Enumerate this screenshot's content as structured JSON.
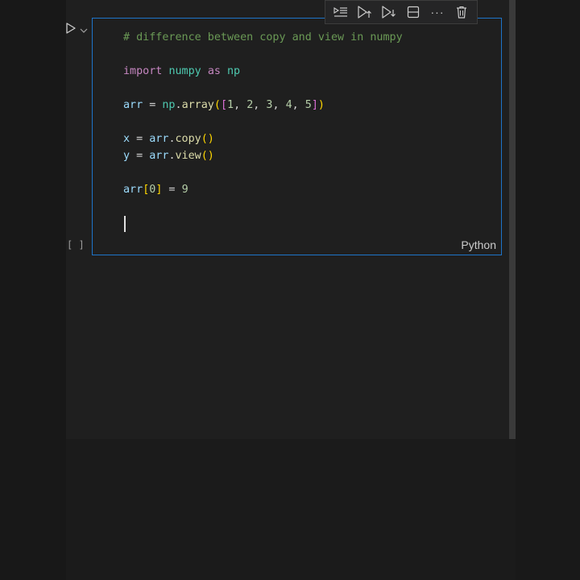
{
  "cell": {
    "language": "Python",
    "execution_count": "[ ]",
    "code_lines": [
      [
        {
          "t": "# difference between copy and view in numpy",
          "c": "comment"
        }
      ],
      [],
      [
        {
          "t": "import",
          "c": "keyword"
        },
        {
          "t": " ",
          "c": "op"
        },
        {
          "t": "numpy",
          "c": "module"
        },
        {
          "t": " ",
          "c": "op"
        },
        {
          "t": "as",
          "c": "keyword"
        },
        {
          "t": " ",
          "c": "op"
        },
        {
          "t": "np",
          "c": "module"
        }
      ],
      [],
      [
        {
          "t": "arr",
          "c": "var"
        },
        {
          "t": " = ",
          "c": "op"
        },
        {
          "t": "np",
          "c": "module"
        },
        {
          "t": ".",
          "c": "op"
        },
        {
          "t": "array",
          "c": "func"
        },
        {
          "t": "(",
          "c": "paren1"
        },
        {
          "t": "[",
          "c": "paren2"
        },
        {
          "t": "1",
          "c": "num"
        },
        {
          "t": ", ",
          "c": "op"
        },
        {
          "t": "2",
          "c": "num"
        },
        {
          "t": ", ",
          "c": "op"
        },
        {
          "t": "3",
          "c": "num"
        },
        {
          "t": ", ",
          "c": "op"
        },
        {
          "t": "4",
          "c": "num"
        },
        {
          "t": ", ",
          "c": "op"
        },
        {
          "t": "5",
          "c": "num"
        },
        {
          "t": "]",
          "c": "paren2"
        },
        {
          "t": ")",
          "c": "paren1"
        }
      ],
      [],
      [
        {
          "t": "x",
          "c": "var"
        },
        {
          "t": " = ",
          "c": "op"
        },
        {
          "t": "arr",
          "c": "var"
        },
        {
          "t": ".",
          "c": "op"
        },
        {
          "t": "copy",
          "c": "func"
        },
        {
          "t": "()",
          "c": "paren1"
        }
      ],
      [
        {
          "t": "y",
          "c": "var"
        },
        {
          "t": " = ",
          "c": "op"
        },
        {
          "t": "arr",
          "c": "var"
        },
        {
          "t": ".",
          "c": "op"
        },
        {
          "t": "view",
          "c": "func"
        },
        {
          "t": "()",
          "c": "paren1"
        }
      ],
      [],
      [
        {
          "t": "arr",
          "c": "var"
        },
        {
          "t": "[",
          "c": "paren1"
        },
        {
          "t": "0",
          "c": "num"
        },
        {
          "t": "]",
          "c": "paren1"
        },
        {
          "t": " = ",
          "c": "op"
        },
        {
          "t": "9",
          "c": "num"
        }
      ],
      []
    ]
  },
  "toolbar": {
    "icons": [
      "execute-above-icon",
      "run-above-icon",
      "run-below-icon",
      "split-cell-icon",
      "more-icon",
      "delete-icon"
    ],
    "more_label": "···"
  },
  "run_icon": "play-icon",
  "colors": {
    "cell_border": "#1e74c9",
    "background": "#1f1f1f"
  }
}
